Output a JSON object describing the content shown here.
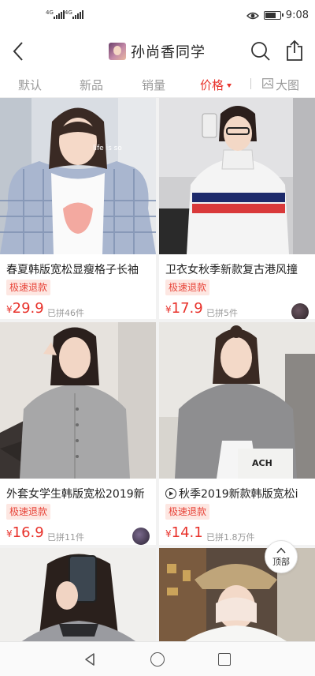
{
  "status": {
    "sim1": "4G",
    "sim2": "4G",
    "battery_percent": 80,
    "time": "9:08"
  },
  "nav": {
    "shop_name": "孙尚香同学"
  },
  "sort": {
    "items": [
      "默认",
      "新品",
      "销量",
      "价格",
      "大图"
    ],
    "active": "价格"
  },
  "products": [
    {
      "title": "春夏韩版宽松显瘦格子长袖",
      "badge": "极速退款",
      "currency": "¥",
      "price": "29.9",
      "sold": "已拼46件",
      "image_text": "life is so",
      "has_video": false,
      "has_buyer_avatar": false
    },
    {
      "title": "卫衣女秋季新款复古港风撞",
      "badge": "极速退款",
      "currency": "¥",
      "price": "17.9",
      "sold": "已拼5件",
      "has_video": false,
      "has_buyer_avatar": true
    },
    {
      "title": "外套女学生韩版宽松2019新",
      "badge": "极速退款",
      "currency": "¥",
      "price": "16.9",
      "sold": "已拼11件",
      "has_video": false,
      "has_buyer_avatar": true
    },
    {
      "title": "秋季2019新款韩版宽松i",
      "badge": "极速退款",
      "currency": "¥",
      "price": "14.1",
      "sold": "已拼1.8万件",
      "image_text": "ACH",
      "has_video": true,
      "has_buyer_avatar": false
    },
    {
      "title": "",
      "badge": "",
      "currency": "",
      "price": "",
      "sold": "",
      "has_video": false,
      "has_buyer_avatar": false
    },
    {
      "title": "",
      "badge": "",
      "currency": "",
      "price": "",
      "sold": "",
      "has_video": false,
      "has_buyer_avatar": false
    }
  ],
  "back_to_top_label": "顶部",
  "colors": {
    "accent_red": "#e8322b",
    "badge_bg": "#fde7e2"
  }
}
